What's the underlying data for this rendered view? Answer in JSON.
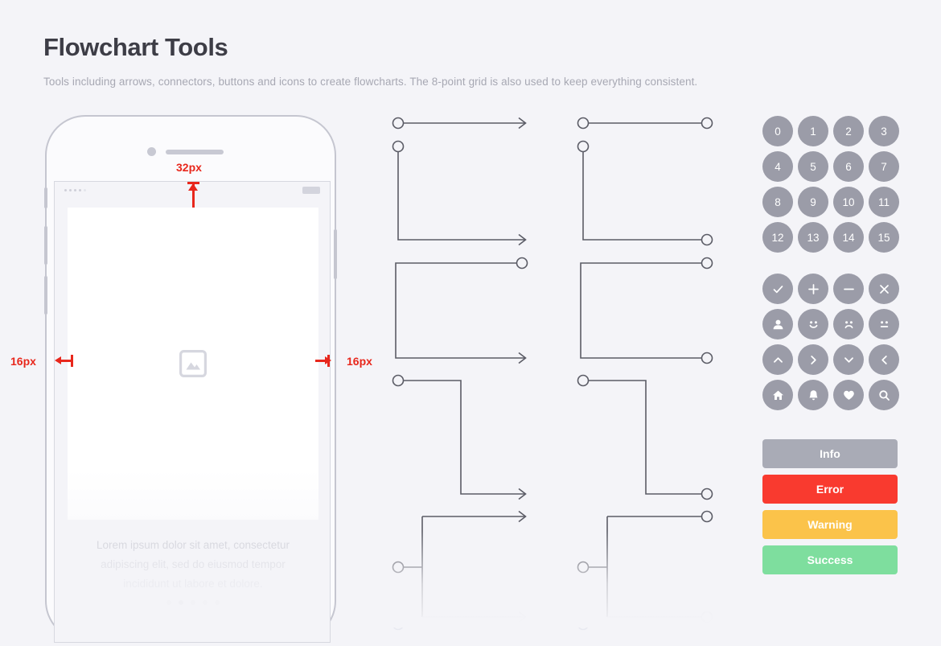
{
  "header": {
    "title": "Flowchart Tools",
    "subtitle": "Tools including arrows, connectors, buttons and icons to create flowcharts. The 8-point grid is also used to keep everything consistent."
  },
  "phone": {
    "caption_line_1": "Lorem ipsum dolor sit amet, consectetur",
    "caption_line_2": "adipiscing elit, sed do eiusmod tempor",
    "caption_line_3": "incididunt ut labore et dolore.",
    "image_placeholder_icon": "image-placeholder-icon",
    "status_bar": {
      "signal_icon": "signal-dots-icon",
      "battery_icon": "battery-icon"
    },
    "page_dots_count": 5,
    "page_dots_active_index": 1
  },
  "annotations": [
    {
      "name": "spacing-top",
      "label": "32px"
    },
    {
      "name": "spacing-left",
      "label": "16px"
    },
    {
      "name": "spacing-right",
      "label": "16px"
    }
  ],
  "connectors": {
    "column_1_name": "arrow-connectors",
    "column_2_name": "circle-connectors",
    "line_color": "#5b5c66",
    "endpoint_style_column_1": "circle-to-arrow",
    "endpoint_style_column_2": "circle-to-circle",
    "shapes": [
      "straight-horizontal",
      "elbow-down-right",
      "elbow-up-right",
      "z-step-down",
      "branch-split"
    ]
  },
  "right_rail": {
    "number_badges": [
      "0",
      "1",
      "2",
      "3",
      "4",
      "5",
      "6",
      "7",
      "8",
      "9",
      "10",
      "11",
      "12",
      "13",
      "14",
      "15"
    ],
    "icon_badges": [
      "check-icon",
      "plus-icon",
      "minus-icon",
      "close-icon",
      "person-icon",
      "smiley-happy-icon",
      "smiley-sad-icon",
      "smiley-neutral-icon",
      "chevron-up-icon",
      "chevron-right-icon",
      "chevron-down-icon",
      "chevron-left-icon",
      "home-icon",
      "bell-icon",
      "heart-icon",
      "search-icon"
    ],
    "badge_color": "#9b9ca8",
    "status_buttons": [
      {
        "label": "Info",
        "color": "#a9abb6"
      },
      {
        "label": "Error",
        "color": "#f93a2f"
      },
      {
        "label": "Warning",
        "color": "#fbc34a"
      },
      {
        "label": "Success",
        "color": "#7ede9e"
      }
    ]
  },
  "colors": {
    "background": "#f4f4f8",
    "title": "#3d3d46",
    "subtitle": "#a7a8b3",
    "annotation_red": "#e8271c",
    "phone_frame": "#c5c6d0"
  }
}
